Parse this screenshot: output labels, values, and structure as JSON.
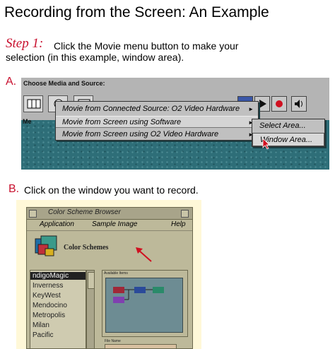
{
  "title": "Recording from the Screen: An Example",
  "step": {
    "label": "Step 1:",
    "text_line1": "Click the Movie menu button to make your",
    "text_line2": "selection (in this example, window area)."
  },
  "section_a": {
    "label": "A.",
    "choose_label": "Choose Media and Source:",
    "side_label": "Me",
    "menu": {
      "items": [
        "Movie from Connected Source: O2 Video Hardware",
        "Movie from Screen using Software",
        "Movie from Screen using O2 Video Hardware"
      ],
      "arrow": "►"
    },
    "submenu": {
      "items": [
        "Select Area...",
        "Window Area..."
      ]
    },
    "colors": {
      "desktop": "#2e6e78",
      "menu": "#c0c0c0",
      "record": "#d01020",
      "pointer": "#d01020"
    }
  },
  "section_b": {
    "label": "B.",
    "text": "Click on the window you want to record.",
    "window": {
      "title": "Color Scheme Browser",
      "menu": [
        "Application",
        "Sample Image",
        "Help"
      ],
      "heading": "Color Schemes",
      "list": [
        "ndigoMagic",
        "Inverness",
        "KeyWest",
        "Mendocino",
        "Metropolis",
        "Milan",
        "Pacific"
      ],
      "available_label": "Available Items",
      "file_label": "File Name"
    },
    "colors": {
      "window": "#bdb99a",
      "arrow": "#d01020"
    }
  }
}
